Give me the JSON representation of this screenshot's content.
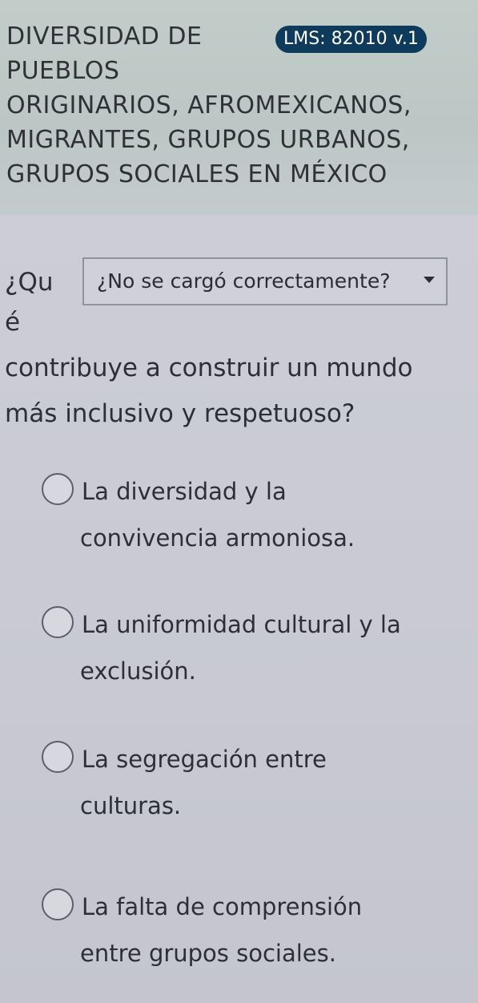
{
  "header": {
    "title_lines": [
      "DIVERSIDAD DE",
      "PUEBLOS",
      "ORIGINARIOS, AFROMEXICANOS,",
      "MIGRANTES, GRUPOS URBANOS,",
      "GRUPOS SOCIALES EN MÉXICO"
    ],
    "lms_badge": "LMS: 82010 v.1"
  },
  "question": {
    "prefix_line1": "¿Qu",
    "prefix_line2": "é",
    "line3": "contribuye a construir un mundo",
    "line4": "más inclusivo y respetuoso?"
  },
  "dropdown": {
    "label": "¿No se cargó correctamente?",
    "icon": "caret-down-icon"
  },
  "options": [
    {
      "line1": "La diversidad y la",
      "line2": "convivencia armoniosa."
    },
    {
      "line1": "La uniformidad cultural y la",
      "line2": "exclusión."
    },
    {
      "line1": "La segregación entre",
      "line2": "culturas."
    },
    {
      "line1": "La falta de comprensión",
      "line2": "entre grupos sociales."
    }
  ],
  "colors": {
    "badge_bg": "#0e3a5c",
    "header_bg": "#c2ccc9",
    "body_bg": "#cccdd6"
  }
}
